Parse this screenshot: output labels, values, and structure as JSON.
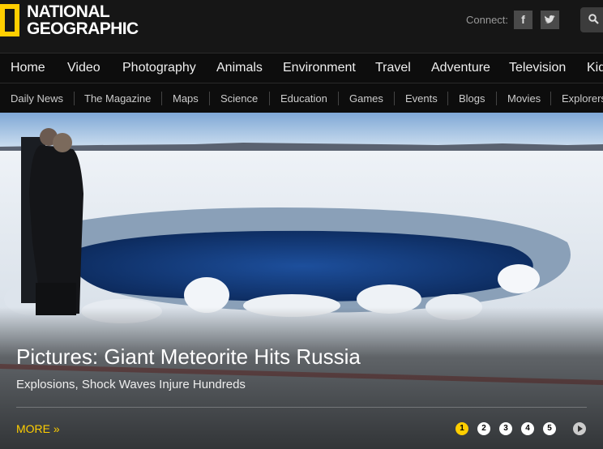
{
  "brand": {
    "line1": "NATIONAL",
    "line2": "GEOGRAPHIC",
    "accent": "#ffce00"
  },
  "header": {
    "connect_label": "Connect:",
    "facebook_glyph": "f",
    "twitter_glyph": "t",
    "search_icon": "search-icon"
  },
  "main_nav": [
    "Home",
    "Video",
    "Photography",
    "Animals",
    "Environment",
    "Travel",
    "Adventure",
    "Television",
    "Kids"
  ],
  "sub_nav": [
    "Daily News",
    "The Magazine",
    "Maps",
    "Science",
    "Education",
    "Games",
    "Events",
    "Blogs",
    "Movies",
    "Explorers"
  ],
  "hero": {
    "headline": "Pictures: Giant Meteorite Hits Russia",
    "subhead": "Explosions, Shock Waves Injure Hundreds",
    "more_label": "MORE »",
    "pages": [
      "1",
      "2",
      "3",
      "4",
      "5"
    ],
    "active_page": "1"
  }
}
